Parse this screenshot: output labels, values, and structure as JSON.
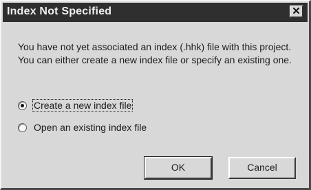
{
  "dialog": {
    "title": "Index Not Specified",
    "close_label": "✕",
    "message": "You have not yet associated an index (.hhk) file with this project. You can either create a new index file or specify an existing one."
  },
  "options": [
    {
      "label": "Create a new index file",
      "selected": true
    },
    {
      "label": "Open an existing index file",
      "selected": false
    }
  ],
  "buttons": {
    "ok": "OK",
    "cancel": "Cancel"
  },
  "icons": {
    "close": "close-icon"
  }
}
